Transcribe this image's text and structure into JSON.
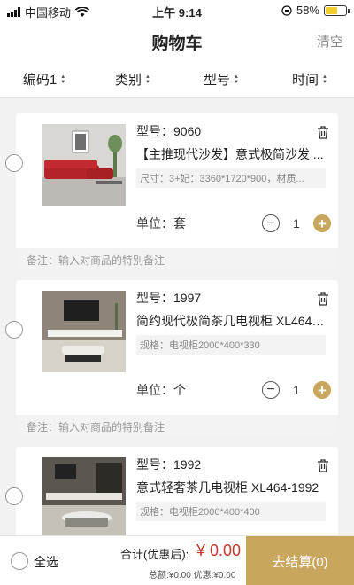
{
  "status_bar": {
    "carrier": "中国移动",
    "time": "上午 9:14",
    "battery": "58%",
    "battery_level": 0.58
  },
  "header": {
    "title": "购物车",
    "clear": "清空"
  },
  "sort_bar": {
    "items": [
      {
        "label": "编码1"
      },
      {
        "label": "类别"
      },
      {
        "label": "型号"
      },
      {
        "label": "时间"
      }
    ]
  },
  "cart": {
    "items": [
      {
        "model": "型号：9060",
        "name": "【主推现代沙发】意式极简沙发 ...",
        "spec": "尺寸：3+妃：3360*1720*900，材质...",
        "unit": "单位：套",
        "quantity": "1",
        "note": "备注：输入对商品的特别备注"
      },
      {
        "model": "型号：1997",
        "name": "简约现代极简茶几电视柜 XL464-...",
        "spec": "规格：电视柜2000*400*330",
        "unit": "单位：个",
        "quantity": "1",
        "note": "备注：输入对商品的特别备注"
      },
      {
        "model": "型号：1992",
        "name": "意式轻奢茶几电视柜 XL464-1992",
        "spec": "规格：电视柜2000*400*400",
        "unit": "",
        "quantity": "",
        "note": ""
      }
    ]
  },
  "footer": {
    "select_all": "全选",
    "total_label": "合计(优惠后):",
    "total_value": "¥ 0.00",
    "sub_total": "总额:¥0.00 优惠:¥0.00",
    "checkout": "去结算(0)"
  },
  "colors": {
    "accent": "#c9a65e",
    "price": "#c0392b"
  }
}
